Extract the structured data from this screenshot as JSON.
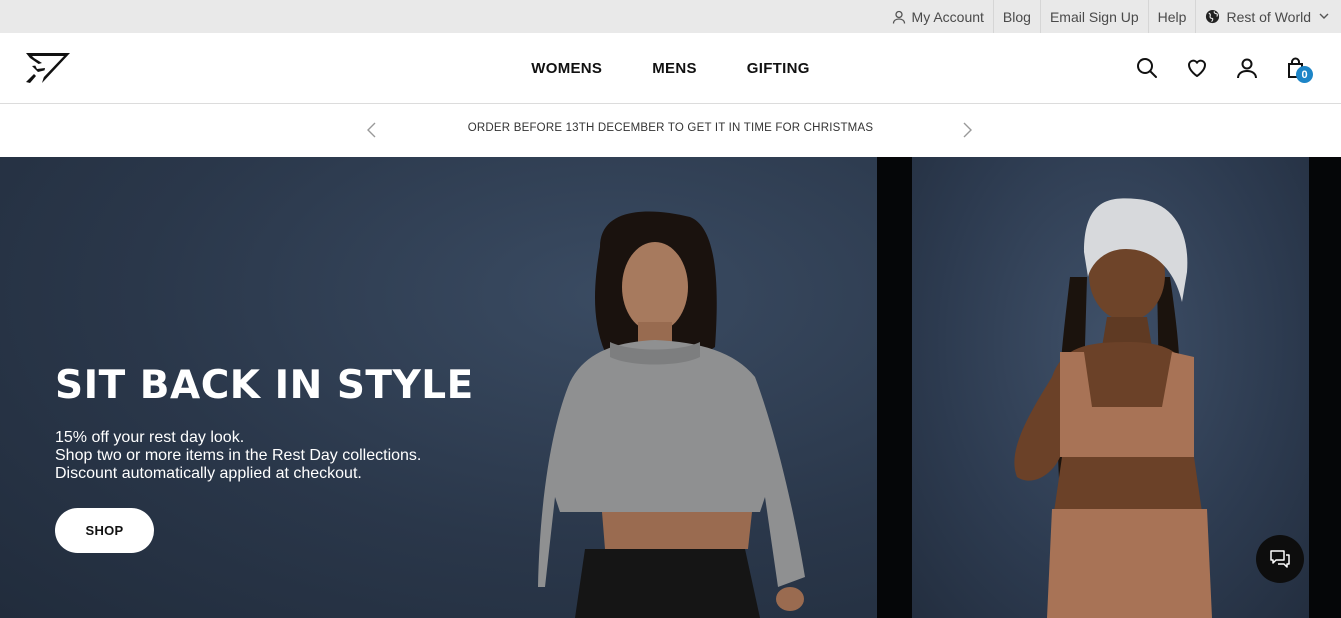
{
  "utility_bar": {
    "my_account": "My Account",
    "blog": "Blog",
    "email_signup": "Email Sign Up",
    "help": "Help",
    "region": "Rest of World"
  },
  "header": {
    "nav": [
      "WOMENS",
      "MENS",
      "GIFTING"
    ],
    "bag_count": "0"
  },
  "promo": {
    "message": "ORDER BEFORE 13TH DECEMBER TO GET IT IN TIME FOR CHRISTMAS"
  },
  "hero": {
    "title": "SIT BACK IN STYLE",
    "lines": [
      "15% off your rest day look.",
      "Shop two or more items in the Rest Day collections.",
      "Discount automatically applied at checkout."
    ],
    "cta": "SHOP"
  },
  "colors": {
    "accent_badge": "#1d85c7",
    "hero_bg": "#2c3a4d"
  },
  "icons": [
    "user-icon",
    "globe-icon",
    "chevron-down-icon",
    "search-icon",
    "heart-icon",
    "account-icon",
    "bag-icon",
    "chevron-left-icon",
    "chevron-right-icon",
    "chat-icon"
  ]
}
